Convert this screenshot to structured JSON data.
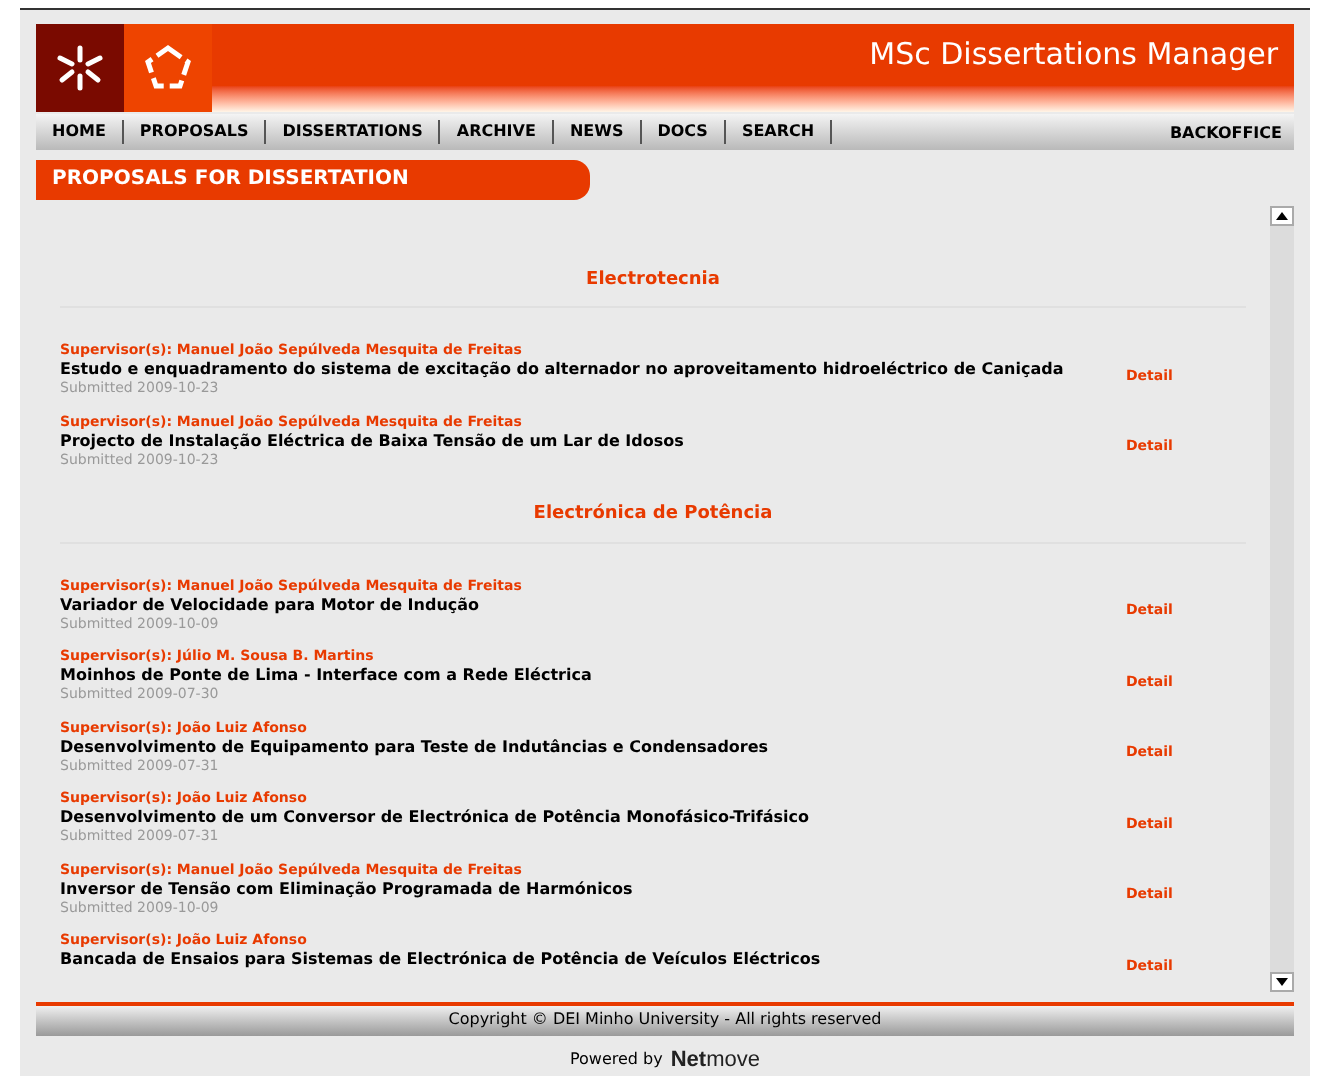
{
  "header": {
    "title": "MSc Dissertations Manager"
  },
  "nav": {
    "items": [
      {
        "label": "HOME"
      },
      {
        "label": "PROPOSALS"
      },
      {
        "label": "DISSERTATIONS"
      },
      {
        "label": "ARCHIVE"
      },
      {
        "label": "NEWS"
      },
      {
        "label": "DOCS"
      },
      {
        "label": "SEARCH"
      }
    ],
    "backoffice": "BACKOFFICE"
  },
  "page_title": "PROPOSALS FOR DISSERTATION",
  "sections": [
    {
      "heading": "Electrotecnia",
      "proposals": [
        {
          "supervisor": "Supervisor(s): Manuel João Sepúlveda Mesquita de Freitas",
          "title": "Estudo e enquadramento do sistema de excitação do alternador no aproveitamento hidroeléctrico de Caniçada",
          "submitted": "Submitted 2009-10-23",
          "action": "Detail"
        },
        {
          "supervisor": "Supervisor(s): Manuel João Sepúlveda Mesquita de Freitas",
          "title": "Projecto de Instalação Eléctrica de Baixa Tensão de um Lar de Idosos",
          "submitted": "Submitted 2009-10-23",
          "action": "Detail"
        }
      ]
    },
    {
      "heading": "Electrónica de Potência",
      "proposals": [
        {
          "supervisor": "Supervisor(s): Manuel João Sepúlveda Mesquita de Freitas",
          "title": "Variador de Velocidade para Motor de Indução",
          "submitted": "Submitted 2009-10-09",
          "action": "Detail"
        },
        {
          "supervisor": "Supervisor(s): Júlio M. Sousa B. Martins",
          "title": "Moinhos de Ponte de Lima - Interface com a Rede Eléctrica",
          "submitted": "Submitted 2009-07-30",
          "action": "Detail"
        },
        {
          "supervisor": "Supervisor(s): João Luiz Afonso",
          "title": "Desenvolvimento de Equipamento para Teste de Indutâncias e Condensadores",
          "submitted": "Submitted 2009-07-31",
          "action": "Detail"
        },
        {
          "supervisor": "Supervisor(s): João Luiz Afonso",
          "title": "Desenvolvimento de um Conversor de Electrónica de Potência Monofásico-Trifásico",
          "submitted": "Submitted 2009-07-31",
          "action": "Detail"
        },
        {
          "supervisor": "Supervisor(s): Manuel João Sepúlveda Mesquita de Freitas",
          "title": "Inversor de Tensão com Eliminação Programada de Harmónicos",
          "submitted": "Submitted 2009-10-09",
          "action": "Detail"
        },
        {
          "supervisor": "Supervisor(s): João Luiz Afonso",
          "title": "Bancada de Ensaios para Sistemas de Electrónica de Potência de Veículos Eléctricos",
          "action": "Detail"
        }
      ]
    }
  ],
  "footer": {
    "copyright": "Copyright © DEI Minho University - All rights reserved",
    "powered_by": "Powered by",
    "brand": "**Net**move"
  }
}
